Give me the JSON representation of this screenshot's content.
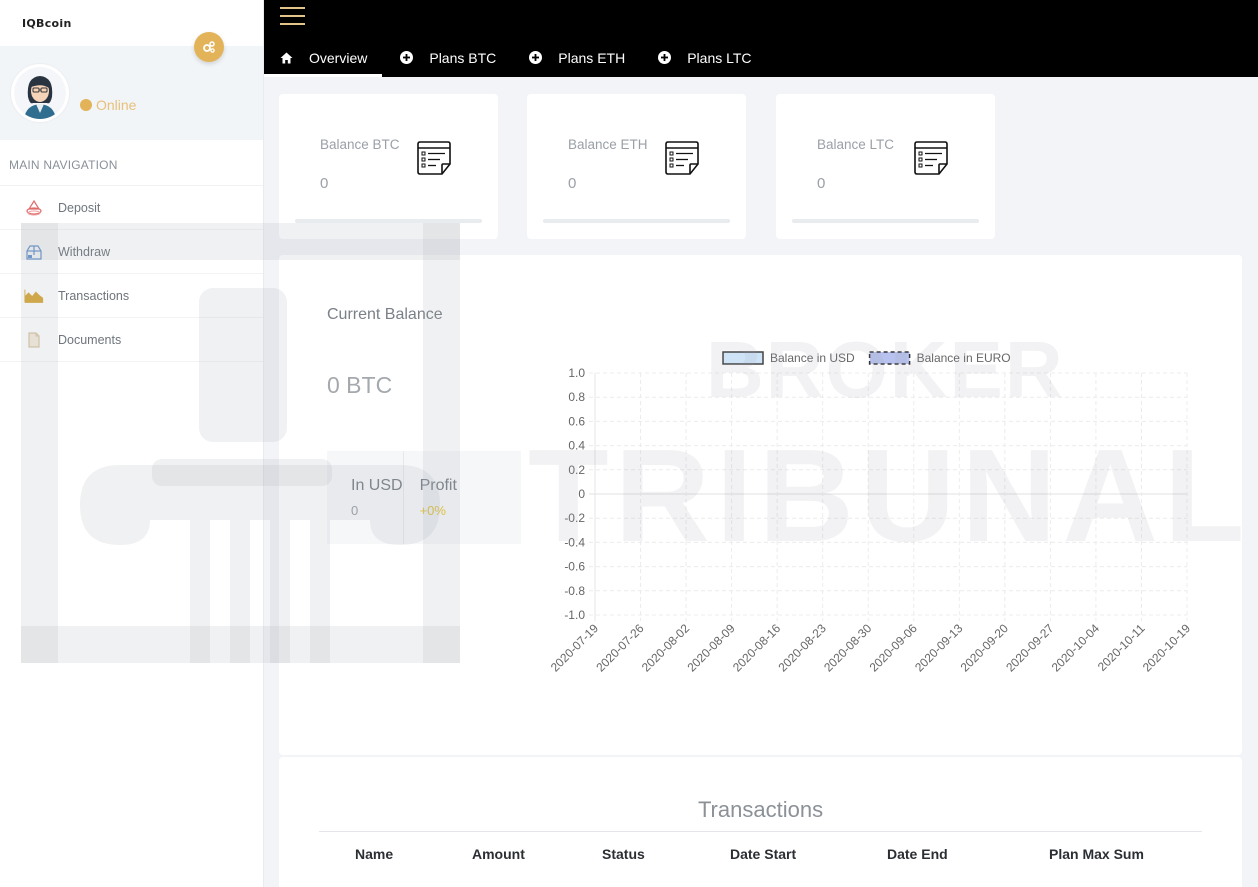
{
  "app": {
    "brand": "IQBcoin"
  },
  "sidebar": {
    "status_label": "Online",
    "nav_header": "MAIN NAVIGATION",
    "items": [
      {
        "label": "Deposit",
        "icon": "deposit-icon",
        "color": "#e06b6b"
      },
      {
        "label": "Withdraw",
        "icon": "withdraw-icon",
        "color": "#5b8fd1"
      },
      {
        "label": "Transactions",
        "icon": "area-chart-icon",
        "color": "#d9a83a"
      },
      {
        "label": "Documents",
        "icon": "document-icon",
        "color": "#d9c7a8"
      }
    ]
  },
  "topbar": {
    "tabs": [
      {
        "label": "Overview",
        "icon": "home-icon",
        "active": true
      },
      {
        "label": "Plans BTC",
        "icon": "plus-circle-icon",
        "active": false
      },
      {
        "label": "Plans ETH",
        "icon": "plus-circle-icon",
        "active": false
      },
      {
        "label": "Plans LTC",
        "icon": "plus-circle-icon",
        "active": false
      }
    ]
  },
  "balances": [
    {
      "label": "Balance BTC",
      "value": "0"
    },
    {
      "label": "Balance ETH",
      "value": "0"
    },
    {
      "label": "Balance LTC",
      "value": "0"
    }
  ],
  "current_balance": {
    "title": "Current Balance",
    "value": "0 BTC",
    "in_usd_label": "In USD",
    "in_usd_value": "0",
    "profit_label": "Profit",
    "profit_value": "+0%"
  },
  "chart_data": {
    "type": "line",
    "title": "",
    "xlabel": "",
    "ylabel": "",
    "x": [
      "2020-07-19",
      "2020-07-26",
      "2020-08-02",
      "2020-08-09",
      "2020-08-16",
      "2020-08-23",
      "2020-08-30",
      "2020-09-06",
      "2020-09-13",
      "2020-09-20",
      "2020-09-27",
      "2020-10-04",
      "2020-10-11",
      "2020-10-19"
    ],
    "yticks": [
      "1.0",
      "0.8",
      "0.6",
      "0.4",
      "0.2",
      "0",
      "-0.2",
      "-0.4",
      "-0.6",
      "-0.8",
      "-1.0"
    ],
    "ylim": [
      -1.0,
      1.0
    ],
    "grid": true,
    "legend_position": "top-center",
    "series": [
      {
        "name": "Balance in USD",
        "values": [],
        "color": "#cfe3f7",
        "border": "#444444",
        "dashed": false
      },
      {
        "name": "Balance in EURO",
        "values": [],
        "color": "#b7c3ee",
        "border": "#333333",
        "dashed": true
      }
    ]
  },
  "transactions": {
    "title": "Transactions",
    "columns": [
      "Name",
      "Amount",
      "Status",
      "Date Start",
      "Date End",
      "Plan Max Sum"
    ],
    "rows": []
  },
  "watermark": {
    "line1": "BROKER",
    "line2": "TRIBUNAL"
  }
}
